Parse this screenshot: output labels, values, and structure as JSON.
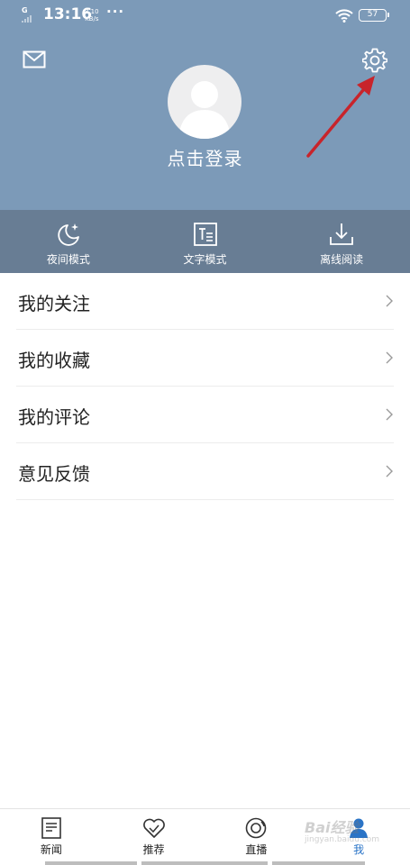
{
  "status_bar": {
    "signal_label": "G",
    "time": "13:16",
    "speed_value": "3.10",
    "speed_unit": "KB/s",
    "dots": "···",
    "battery": "57"
  },
  "header": {
    "login_text": "点击登录",
    "background": "#7c9ab8"
  },
  "modes": [
    {
      "label": "夜间模式",
      "icon": "moon-icon"
    },
    {
      "label": "文字模式",
      "icon": "text-mode-icon"
    },
    {
      "label": "离线阅读",
      "icon": "download-icon"
    }
  ],
  "menu": [
    {
      "label": "我的关注"
    },
    {
      "label": "我的收藏"
    },
    {
      "label": "我的评论"
    },
    {
      "label": "意见反馈"
    }
  ],
  "tabbar": {
    "accent": "#2a74c7",
    "tabs": [
      {
        "label": "新闻",
        "icon": "news-icon"
      },
      {
        "label": "推荐",
        "icon": "heart-icon"
      },
      {
        "label": "直播",
        "icon": "live-icon"
      },
      {
        "label": "我",
        "icon": "profile-icon",
        "active": true
      }
    ]
  },
  "watermark": {
    "brand": "Bai经验",
    "url": "jingyan.baidu.com"
  }
}
